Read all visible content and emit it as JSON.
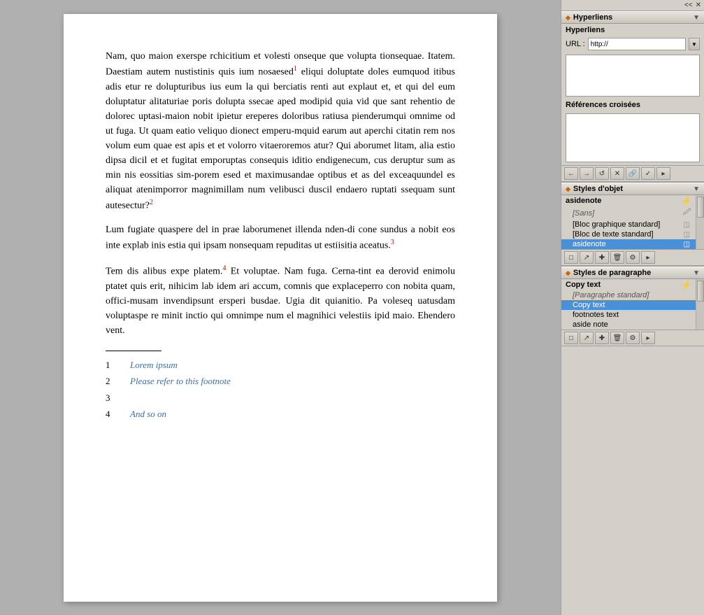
{
  "document": {
    "paragraphs": [
      "Nam, quo maion exerspe rchicitium et volesti onseque que volupta tionsequae. Itatem. Daestiam autem nustistinis quis ium nosaesed",
      " eliqui doluptate doles eumquod itibus adis etur re dolupturibus ius eum la qui berciatis renti aut explaut et, et qui del eum doluptatur alitaturiae poris dolupta ssecae aped modipid quia vid que sant rehentio de dolorec uptasi-maion nobit ipietur ereperes doloribus ratiusa pienderumqui omnime od ut fuga. Ut quam eatio veliquo dionect emperu-mquid earum aut aperchi citatin rem nos volum eum quae est apis et et volorro vitaeroremos atur? Qui aborumet litam, alia estio dipsa dicil et et fugitat emporuptas consequis iditio endigenecum, cus deruptur sum as min nis eossitias sim-porem esed et maximusandae optibus et as del exceaquundel es aliquat atenimporror magnimillam num velibusci duscil endaero ruptati ssequam sunt autesectur?",
      "Lum fugiate quaspere del in prae laborumenet illenda nden-di cone sundus a nobit eos inte explab inis estia qui ipsam nonsequam repuditas ut estiisitia aceatus.",
      "Tem dis alibus expe platem.",
      " Et voluptae. Nam fuga. Cerna-tint ea derovid enimolu ptatet quis erit, nihicim lab idem ari accum, comnis que explaceperro con nobita quam, offici-musam invendipsunt ersperi busdae. Ugia dit quianitio. Pa voleseq uatusdam voluptaspe re minit inctio qui omnimpe num el magnihici velestiis ipid maio. Ehendero vent."
    ],
    "sup1": "1",
    "sup2": "2",
    "sup3": "3",
    "sup4": "4",
    "footnotes": [
      {
        "num": "1",
        "text": "Lorem ipsum"
      },
      {
        "num": "2",
        "text": "Please refer to this footnote"
      },
      {
        "num": "3",
        "text": ""
      },
      {
        "num": "4",
        "text": "And so on"
      }
    ]
  },
  "right_panel": {
    "top_bar": {
      "collapse_label": "<<",
      "close_label": "✕"
    },
    "hyperlinks": {
      "section_title": "Hyperliens",
      "panel_title": "Hyperliens",
      "url_label": "URL :",
      "url_value": "http://",
      "cross_ref_label": "Références croisées"
    },
    "hyperlinks_toolbar": {
      "buttons": [
        "←",
        "→",
        "↺",
        "✕",
        "🔗",
        "✓"
      ]
    },
    "object_styles": {
      "section_title": "Styles d'objet",
      "current_label": "asidenote",
      "thunder_icon": "⚡",
      "items": [
        {
          "label": "[Sans]",
          "type": "normal",
          "has_icon": true
        },
        {
          "label": "[Bloc graphique standard]",
          "type": "normal",
          "has_icon": true
        },
        {
          "label": "[Bloc de texte standard]",
          "type": "normal",
          "has_icon": true
        },
        {
          "label": "asidenote",
          "type": "selected",
          "has_icon": true
        }
      ]
    },
    "object_styles_toolbar": {
      "buttons": [
        "□",
        "↗",
        "✚",
        "🗑",
        "⚙"
      ]
    },
    "para_styles": {
      "section_title": "Styles de paragraphe",
      "current_label": "Copy text",
      "thunder_icon": "⚡",
      "items": [
        {
          "label": "[Paragraphe standard]",
          "type": "italic"
        },
        {
          "label": "Copy text",
          "type": "selected"
        },
        {
          "label": "footnotes text",
          "type": "normal"
        },
        {
          "label": "aside note",
          "type": "normal"
        }
      ]
    },
    "para_styles_toolbar": {
      "buttons": [
        "□",
        "↗",
        "✚",
        "🗑",
        "⚙"
      ]
    }
  }
}
